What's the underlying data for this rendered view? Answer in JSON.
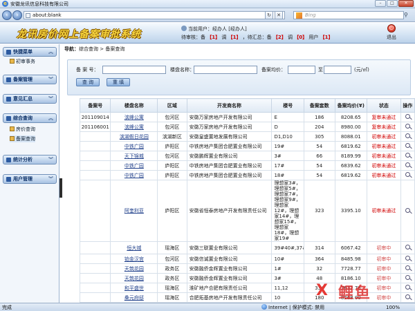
{
  "browser": {
    "window_title": "安徽龙讯信息科技有限公司",
    "address": "about:blank",
    "search_placeholder": "Bing",
    "status_left": "完成",
    "zone": "Internet | 保护模式: 禁用",
    "zoom": "100%"
  },
  "header": {
    "app_title": "龙讯房价网上备案审批系统",
    "current_user_label": "当前用户：",
    "current_user": "经办人 [经办人]",
    "pending_prefix": "待审核：备",
    "pending_count1": "【1】",
    "pending_mid": "调",
    "pending_count2": "【1】",
    "pending_sum_prefix": "，待汇总：备",
    "pending_count3": "【2】",
    "pending_mid2": "调",
    "pending_count4": "【0】",
    "pending_user": "用户",
    "pending_count5": "【1】",
    "exit_label": "退出"
  },
  "sidebar": {
    "groups": [
      {
        "label": "快捷菜单",
        "items": [
          "初审事务"
        ]
      },
      {
        "label": "备案管理",
        "items": []
      },
      {
        "label": "意见汇总",
        "items": []
      },
      {
        "label": "综合查询",
        "items": [
          "房价查询",
          "备案查询"
        ]
      },
      {
        "label": "统计分析",
        "items": []
      },
      {
        "label": "用户管理",
        "items": []
      }
    ]
  },
  "breadcrumb": {
    "nav": "导航：",
    "path": "综合查询 > 备案查询"
  },
  "search_form": {
    "record_no_label": "备 案 号：",
    "project_label": "楼盘名称：",
    "avg_price_label": "备案均价：",
    "to_label": "至",
    "unit": "(元/㎡)",
    "query_button": "查 询",
    "reset_button": "重 填"
  },
  "table": {
    "headers": [
      "备案号",
      "楼盘名称",
      "区域",
      "开发商名称",
      "楼号",
      "备案套数",
      "备案均价(¥)",
      "状态",
      "操作"
    ],
    "rows": [
      {
        "no": "201109014",
        "project": "滨峰公寓",
        "area": "包河区",
        "dev": "安徽万家房地产开发有限公司",
        "bld": "E",
        "units": "186",
        "price": "8208.65",
        "status": "复审未通过",
        "st": "fail"
      },
      {
        "no": "201106001",
        "project": "滨峰公寓",
        "area": "包河区",
        "dev": "安徽万家房地产开发有限公司",
        "bld": "D",
        "units": "204",
        "price": "8980.00",
        "status": "复审未通过",
        "st": "fail"
      },
      {
        "no": "",
        "project": "滨湖假日花园",
        "area": "滨湖新区",
        "dev": "安徽皇盛置地发展有限公司",
        "bld": "D1,D10",
        "units": "305",
        "price": "8088.01",
        "status": "初审未通过",
        "st": "fail"
      },
      {
        "no": "",
        "project": "中铁广园",
        "area": "庐阳区",
        "dev": "中铁房地产集团合肥置业有限公司",
        "bld": "19#",
        "units": "54",
        "price": "6819.62",
        "status": "初审未通过",
        "st": "fail"
      },
      {
        "no": "",
        "project": "天下锦城",
        "area": "包河区",
        "dev": "安徽鹏辉置业有限公司",
        "bld": "3#",
        "units": "66",
        "price": "8189.99",
        "status": "初审未通过",
        "st": "fail"
      },
      {
        "no": "",
        "project": "中铁广园",
        "area": "庐阳区",
        "dev": "中铁房地产集团合肥置业有限公司",
        "bld": "17#",
        "units": "54",
        "price": "6839.62",
        "status": "初审未通过",
        "st": "fail"
      },
      {
        "no": "",
        "project": "中铁广园",
        "area": "庐阳区",
        "dev": "中铁房地产集团合肥置业有限公司",
        "bld": "18#",
        "units": "54",
        "price": "6819.62",
        "status": "初审未通过",
        "st": "fail"
      },
      {
        "no": "",
        "project": "阿奎利亚",
        "area": "庐阳区",
        "dev": "安徽省恒泰房地产开发有限责任公司",
        "bld": "理想家3#，理想家5#，理想家7#，理想家9#，理想家12#，理想家14#，理想家15#，理想家18#，理想家19#",
        "units": "323",
        "price": "3395.10",
        "status": "初审未通过",
        "st": "fail",
        "tall": true
      },
      {
        "no": "",
        "project": "恒大城",
        "area": "瑶海区",
        "dev": "安徽三联置业有限公司",
        "bld": "39#40#,37#38#",
        "units": "314",
        "price": "6067.42",
        "status": "初审中",
        "st": "pending",
        "mid": true
      },
      {
        "no": "",
        "project": "铂金汉宫",
        "area": "包河区",
        "dev": "安徽信诚置业有限公司",
        "bld": "10#",
        "units": "364",
        "price": "8485.98",
        "status": "初审中",
        "st": "pending"
      },
      {
        "no": "",
        "project": "天筑花园",
        "area": "政务区",
        "dev": "安徽融侨金辉置业有限公司",
        "bld": "1#",
        "units": "32",
        "price": "7728.77",
        "status": "初审中",
        "st": "pending"
      },
      {
        "no": "",
        "project": "天筑花园",
        "area": "政务区",
        "dev": "安徽融侨金辉置业有限公司",
        "bld": "3#",
        "units": "48",
        "price": "8186.10",
        "status": "初审中",
        "st": "pending"
      },
      {
        "no": "",
        "project": "和平盛世",
        "area": "瑶海区",
        "dev": "淮矿地产合肥有限责任公司",
        "bld": "11,12",
        "units": "334",
        "price": "7632.78",
        "status": "初审中",
        "st": "pending"
      },
      {
        "no": "",
        "project": "桑元府邸",
        "area": "瑶海区",
        "dev": "合肥拓基房地产开发有限责任公司",
        "bld": "10",
        "units": "180",
        "price": "8268.00",
        "status": "初审中",
        "st": "pending"
      }
    ]
  },
  "watermark": {
    "mark": "X",
    "text": "鲤鱼"
  }
}
